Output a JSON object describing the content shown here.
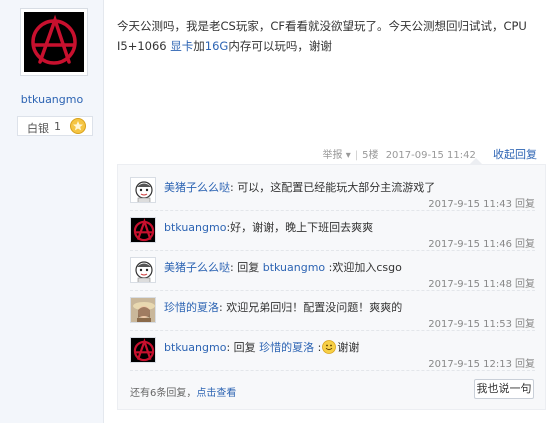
{
  "author": {
    "username": "btkuangmo",
    "rank_label": "白银",
    "rank_level": "1",
    "avatar_icon": "red-anarchy-symbol-icon",
    "rank_badge_icon": "rank-star-badge-icon"
  },
  "post": {
    "text_part1": "今天公测吗，我是老CS玩家，CF看看就没欲望玩了。今天公测想回归试试，CPU I5+1066 ",
    "text_highlight1": "显卡",
    "text_part2": "加",
    "text_highlight2": "16G",
    "text_part3": "内存可以玩吗，谢谢",
    "report": "举报",
    "report_arrow": "▾",
    "floor": "5楼",
    "timestamp": "2017-09-15 11:42",
    "collapse_reply": "收起回复"
  },
  "replies": [
    {
      "user": "美猪子么么哒",
      "prefix": ":",
      "text": "可以，这配置已经能玩大部分主流游戏了",
      "time": "2017-9-15 11:43",
      "reply_label": "回复",
      "avatar_icon": "cartoon-avatar-icon"
    },
    {
      "user": "btkuangmo",
      "prefix": ":",
      "text": "好，谢谢，晚上下班回去爽爽",
      "time": "2017-9-15 11:46",
      "reply_label": "回复",
      "avatar_icon": "red-anarchy-symbol-icon"
    },
    {
      "user": "美猪子么么哒",
      "prefix": ":",
      "reply_word": "回复 ",
      "target": "btkuangmo",
      "text": " :欢迎加入csgo",
      "time": "2017-9-15 11:48",
      "reply_label": "回复",
      "avatar_icon": "cartoon-avatar-icon"
    },
    {
      "user": "珍惜的夏洛",
      "prefix": ":",
      "text": "欢迎兄弟回归！配置没问题！爽爽的",
      "time": "2017-9-15 11:53",
      "reply_label": "回复",
      "avatar_icon": "photo-avatar-icon"
    },
    {
      "user": "btkuangmo",
      "prefix": ":",
      "reply_word": "回复 ",
      "target": "珍惜的夏洛",
      "text_before_emoji": " :",
      "text": "谢谢",
      "time": "2017-9-15 12:13",
      "reply_label": "回复",
      "avatar_icon": "red-anarchy-symbol-icon",
      "emoji_icon": "smile-emoji-icon"
    }
  ],
  "footer": {
    "more_text": "还有6条回复，",
    "more_link": "点击查看",
    "say_button": "我也说一句"
  },
  "colors": {
    "link": "#2d64b3",
    "anarchy_red": "#c8102e"
  }
}
